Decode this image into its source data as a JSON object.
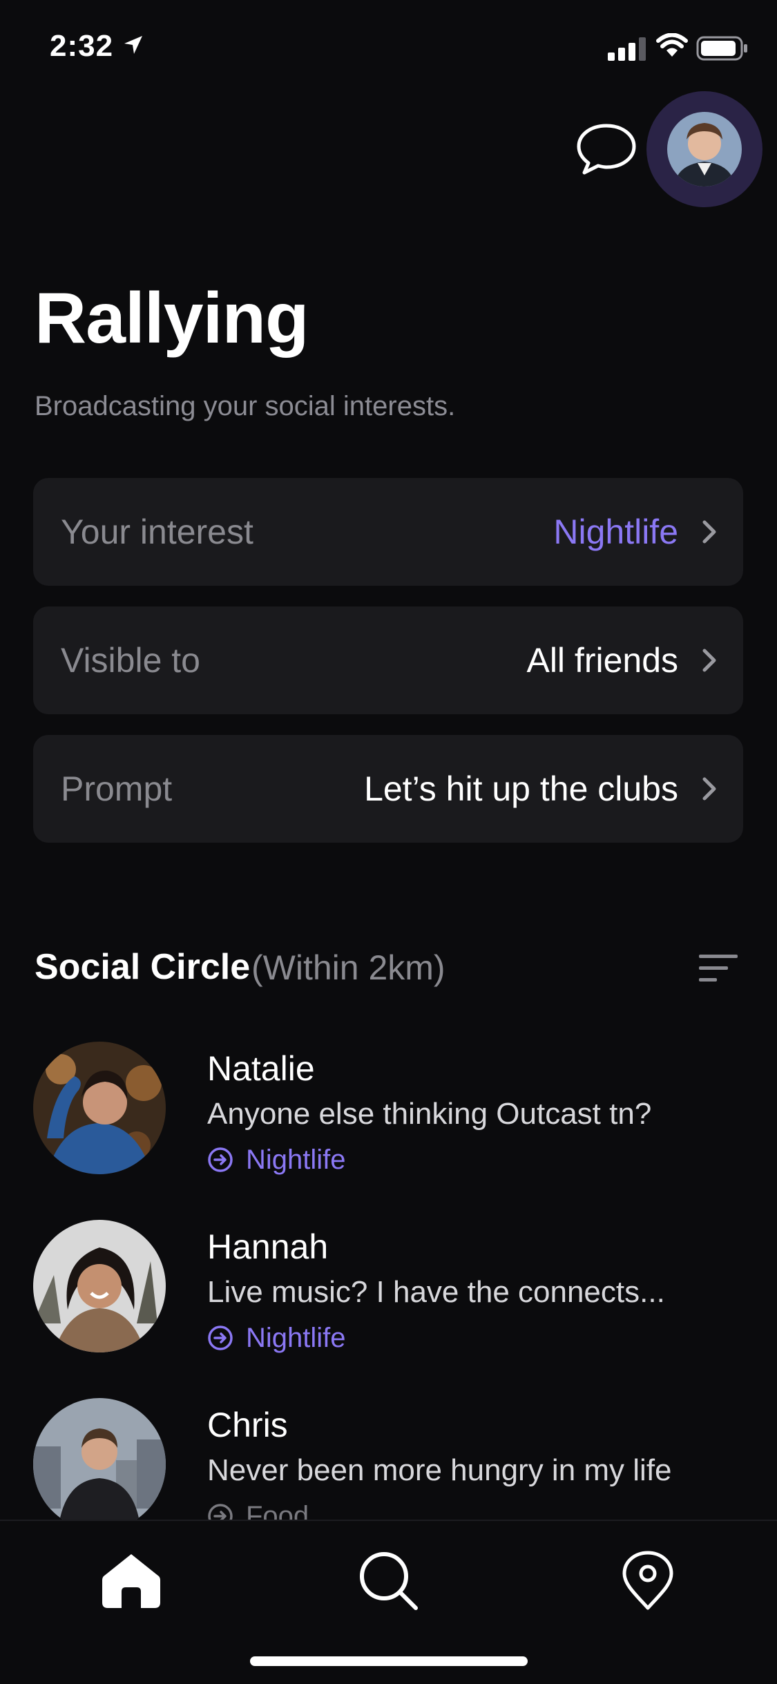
{
  "status_bar": {
    "time": "2:32"
  },
  "header": {
    "title": "Rallying",
    "subtitle": "Broadcasting your social interests."
  },
  "settings": [
    {
      "label": "Your interest",
      "value": "Nightlife"
    },
    {
      "label": "Visible to",
      "value": "All friends"
    },
    {
      "label": "Prompt",
      "value": "Let’s hit up the clubs"
    }
  ],
  "social_circle": {
    "title": "Social Circle",
    "subtitle": "(Within 2km)",
    "people": [
      {
        "name": "Natalie",
        "message": "Anyone else thinking Outcast tn?",
        "tag": "Nightlife"
      },
      {
        "name": "Hannah",
        "message": "Live music? I have the connects...",
        "tag": "Nightlife"
      },
      {
        "name": "Chris",
        "message": "Never been more hungry in my life",
        "tag": "Food"
      }
    ]
  },
  "tabs": [
    {
      "icon": "home-icon",
      "active": true
    },
    {
      "icon": "search-icon",
      "active": false
    },
    {
      "icon": "map-pin-icon",
      "active": false
    }
  ],
  "colors": {
    "background": "#0b0b0d",
    "card": "#1a1a1d",
    "accent": "#8b78f4",
    "muted": "#8a8a90"
  }
}
